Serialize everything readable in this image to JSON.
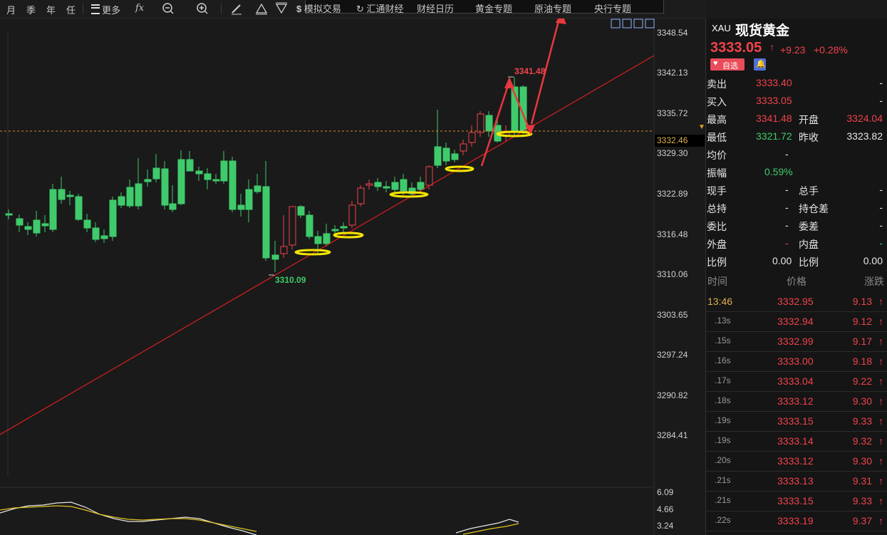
{
  "toolbar": {
    "periods": [
      "月",
      "季",
      "年",
      "任"
    ],
    "more": "更多",
    "fx": "fx",
    "menu": [
      "模拟交易",
      "汇通财经",
      "财经日历",
      "黄金专题",
      "原油专题",
      "央行专题"
    ]
  },
  "price_axis": [
    "3348.54",
    "3342.13",
    "3335.72",
    "3329.30",
    "3322.89",
    "3316.48",
    "3310.06",
    "3303.65",
    "3297.24",
    "3290.82",
    "3284.41"
  ],
  "current_price_label": "3332.46",
  "chart_labels": {
    "high": "3341.48",
    "low": "3310.09"
  },
  "indicator_axis": [
    "6.09",
    "4.66",
    "3.24"
  ],
  "quote": {
    "code": "XAU",
    "name": "现货黄金",
    "price": "3333.05",
    "change": "+9.23",
    "change_pct": "+0.28%",
    "watch_button": "自选",
    "rows": [
      {
        "l1": "卖出",
        "v1": "3333.40",
        "l2": "",
        "v2": "-"
      },
      {
        "l1": "买入",
        "v1": "3333.05",
        "l2": "",
        "v2": "-"
      },
      {
        "l1": "最高",
        "v1": "3341.48",
        "l2": "开盘",
        "v2": "3324.04"
      },
      {
        "l1": "最低",
        "v1": "3321.72",
        "l2": "昨收",
        "v2": "3323.82"
      },
      {
        "l1": "均价",
        "v1": "-",
        "l2": "",
        "v2": ""
      },
      {
        "l1": "振幅",
        "v1": "0.59%",
        "l2": "",
        "v2": ""
      },
      {
        "l1": "现手",
        "v1": "-",
        "l2": "总手",
        "v2": "-"
      },
      {
        "l1": "总持",
        "v1": "-",
        "l2": "持仓差",
        "v2": "-"
      },
      {
        "l1": "委比",
        "v1": "-",
        "l2": "委差",
        "v2": "-"
      },
      {
        "l1": "外盘",
        "v1": "-",
        "l2": "内盘",
        "v2": "-"
      },
      {
        "l1": "比例",
        "v1": "0.00",
        "l2": "比例",
        "v2": "0.00"
      }
    ],
    "ticks_header": [
      "时间",
      "价格",
      "涨跌"
    ],
    "ticks": [
      {
        "t": "13:46",
        "p": "3332.95",
        "c": "9.13"
      },
      {
        "t": ".13s",
        "p": "3332.94",
        "c": "9.12"
      },
      {
        "t": ".15s",
        "p": "3332.99",
        "c": "9.17"
      },
      {
        "t": ".16s",
        "p": "3333.00",
        "c": "9.18"
      },
      {
        "t": ".17s",
        "p": "3333.04",
        "c": "9.22"
      },
      {
        "t": ".18s",
        "p": "3333.12",
        "c": "9.30"
      },
      {
        "t": ".19s",
        "p": "3333.15",
        "c": "9.33"
      },
      {
        "t": ".19s",
        "p": "3333.14",
        "c": "9.32"
      },
      {
        "t": ".20s",
        "p": "3333.12",
        "c": "9.30"
      },
      {
        "t": ".21s",
        "p": "3333.13",
        "c": "9.31"
      },
      {
        "t": ".21s",
        "p": "3333.15",
        "c": "9.33"
      },
      {
        "t": ".22s",
        "p": "3333.19",
        "c": "9.37"
      }
    ]
  },
  "colors": {
    "up": "#f0434b",
    "down": "#3fcb6b",
    "trend": "#d81e1e",
    "annotation": "#f5e600",
    "arrow": "#e8383d"
  }
}
